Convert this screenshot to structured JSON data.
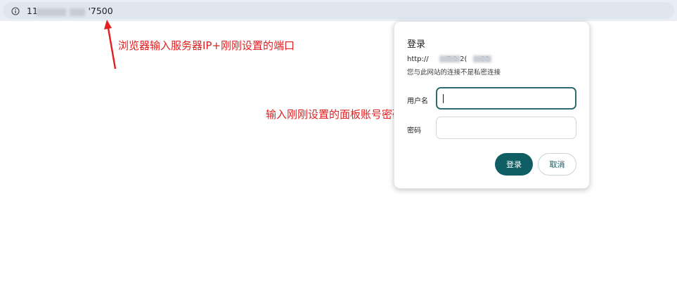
{
  "addressbar": {
    "url_visible_fragment": "11",
    "url_suffix": "'7500",
    "info_icon": "info-icon"
  },
  "annotations": {
    "browser_tip": "浏览器输入服务器IP+刚刚设置的端口",
    "panel_tip": "输入刚刚设置的面板账号密码"
  },
  "dialog": {
    "title": "登录",
    "url_prefix": "http://",
    "url_middle": "7 1 2( ",
    "url_suffix": "00",
    "note": "您与此网站的连接不是私密连接",
    "username_label": "用户名",
    "password_label": "密码",
    "username_value": "",
    "password_value": "",
    "login_label": "登录",
    "cancel_label": "取消"
  },
  "colors": {
    "annotation": "#e02020",
    "accent": "#0e5e64",
    "focused_border": "#2f6b6d"
  }
}
